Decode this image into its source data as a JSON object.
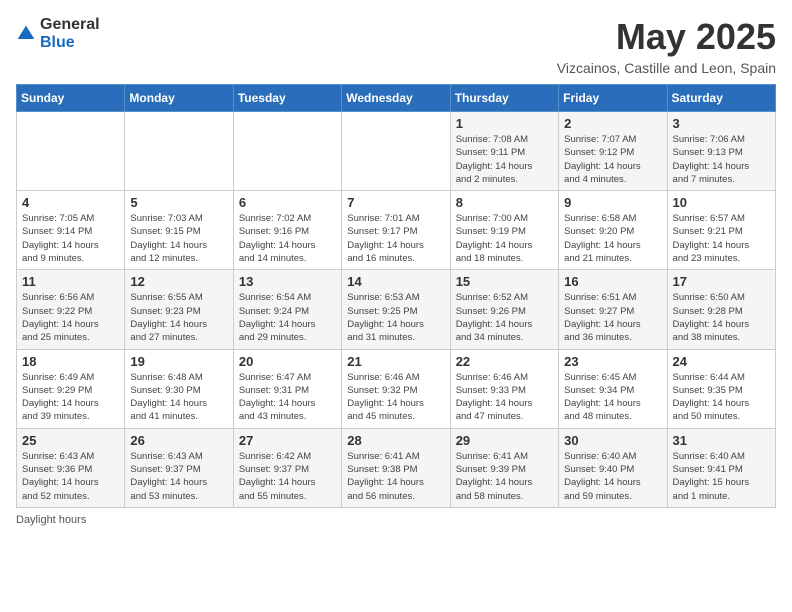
{
  "logo": {
    "general": "General",
    "blue": "Blue"
  },
  "title": "May 2025",
  "location": "Vizcainos, Castille and Leon, Spain",
  "days_of_week": [
    "Sunday",
    "Monday",
    "Tuesday",
    "Wednesday",
    "Thursday",
    "Friday",
    "Saturday"
  ],
  "weeks": [
    [
      {
        "day": "",
        "info": ""
      },
      {
        "day": "",
        "info": ""
      },
      {
        "day": "",
        "info": ""
      },
      {
        "day": "",
        "info": ""
      },
      {
        "day": "1",
        "info": "Sunrise: 7:08 AM\nSunset: 9:11 PM\nDaylight: 14 hours\nand 2 minutes."
      },
      {
        "day": "2",
        "info": "Sunrise: 7:07 AM\nSunset: 9:12 PM\nDaylight: 14 hours\nand 4 minutes."
      },
      {
        "day": "3",
        "info": "Sunrise: 7:06 AM\nSunset: 9:13 PM\nDaylight: 14 hours\nand 7 minutes."
      }
    ],
    [
      {
        "day": "4",
        "info": "Sunrise: 7:05 AM\nSunset: 9:14 PM\nDaylight: 14 hours\nand 9 minutes."
      },
      {
        "day": "5",
        "info": "Sunrise: 7:03 AM\nSunset: 9:15 PM\nDaylight: 14 hours\nand 12 minutes."
      },
      {
        "day": "6",
        "info": "Sunrise: 7:02 AM\nSunset: 9:16 PM\nDaylight: 14 hours\nand 14 minutes."
      },
      {
        "day": "7",
        "info": "Sunrise: 7:01 AM\nSunset: 9:17 PM\nDaylight: 14 hours\nand 16 minutes."
      },
      {
        "day": "8",
        "info": "Sunrise: 7:00 AM\nSunset: 9:19 PM\nDaylight: 14 hours\nand 18 minutes."
      },
      {
        "day": "9",
        "info": "Sunrise: 6:58 AM\nSunset: 9:20 PM\nDaylight: 14 hours\nand 21 minutes."
      },
      {
        "day": "10",
        "info": "Sunrise: 6:57 AM\nSunset: 9:21 PM\nDaylight: 14 hours\nand 23 minutes."
      }
    ],
    [
      {
        "day": "11",
        "info": "Sunrise: 6:56 AM\nSunset: 9:22 PM\nDaylight: 14 hours\nand 25 minutes."
      },
      {
        "day": "12",
        "info": "Sunrise: 6:55 AM\nSunset: 9:23 PM\nDaylight: 14 hours\nand 27 minutes."
      },
      {
        "day": "13",
        "info": "Sunrise: 6:54 AM\nSunset: 9:24 PM\nDaylight: 14 hours\nand 29 minutes."
      },
      {
        "day": "14",
        "info": "Sunrise: 6:53 AM\nSunset: 9:25 PM\nDaylight: 14 hours\nand 31 minutes."
      },
      {
        "day": "15",
        "info": "Sunrise: 6:52 AM\nSunset: 9:26 PM\nDaylight: 14 hours\nand 34 minutes."
      },
      {
        "day": "16",
        "info": "Sunrise: 6:51 AM\nSunset: 9:27 PM\nDaylight: 14 hours\nand 36 minutes."
      },
      {
        "day": "17",
        "info": "Sunrise: 6:50 AM\nSunset: 9:28 PM\nDaylight: 14 hours\nand 38 minutes."
      }
    ],
    [
      {
        "day": "18",
        "info": "Sunrise: 6:49 AM\nSunset: 9:29 PM\nDaylight: 14 hours\nand 39 minutes."
      },
      {
        "day": "19",
        "info": "Sunrise: 6:48 AM\nSunset: 9:30 PM\nDaylight: 14 hours\nand 41 minutes."
      },
      {
        "day": "20",
        "info": "Sunrise: 6:47 AM\nSunset: 9:31 PM\nDaylight: 14 hours\nand 43 minutes."
      },
      {
        "day": "21",
        "info": "Sunrise: 6:46 AM\nSunset: 9:32 PM\nDaylight: 14 hours\nand 45 minutes."
      },
      {
        "day": "22",
        "info": "Sunrise: 6:46 AM\nSunset: 9:33 PM\nDaylight: 14 hours\nand 47 minutes."
      },
      {
        "day": "23",
        "info": "Sunrise: 6:45 AM\nSunset: 9:34 PM\nDaylight: 14 hours\nand 48 minutes."
      },
      {
        "day": "24",
        "info": "Sunrise: 6:44 AM\nSunset: 9:35 PM\nDaylight: 14 hours\nand 50 minutes."
      }
    ],
    [
      {
        "day": "25",
        "info": "Sunrise: 6:43 AM\nSunset: 9:36 PM\nDaylight: 14 hours\nand 52 minutes."
      },
      {
        "day": "26",
        "info": "Sunrise: 6:43 AM\nSunset: 9:37 PM\nDaylight: 14 hours\nand 53 minutes."
      },
      {
        "day": "27",
        "info": "Sunrise: 6:42 AM\nSunset: 9:37 PM\nDaylight: 14 hours\nand 55 minutes."
      },
      {
        "day": "28",
        "info": "Sunrise: 6:41 AM\nSunset: 9:38 PM\nDaylight: 14 hours\nand 56 minutes."
      },
      {
        "day": "29",
        "info": "Sunrise: 6:41 AM\nSunset: 9:39 PM\nDaylight: 14 hours\nand 58 minutes."
      },
      {
        "day": "30",
        "info": "Sunrise: 6:40 AM\nSunset: 9:40 PM\nDaylight: 14 hours\nand 59 minutes."
      },
      {
        "day": "31",
        "info": "Sunrise: 6:40 AM\nSunset: 9:41 PM\nDaylight: 15 hours\nand 1 minute."
      }
    ]
  ],
  "footer": "Daylight hours"
}
